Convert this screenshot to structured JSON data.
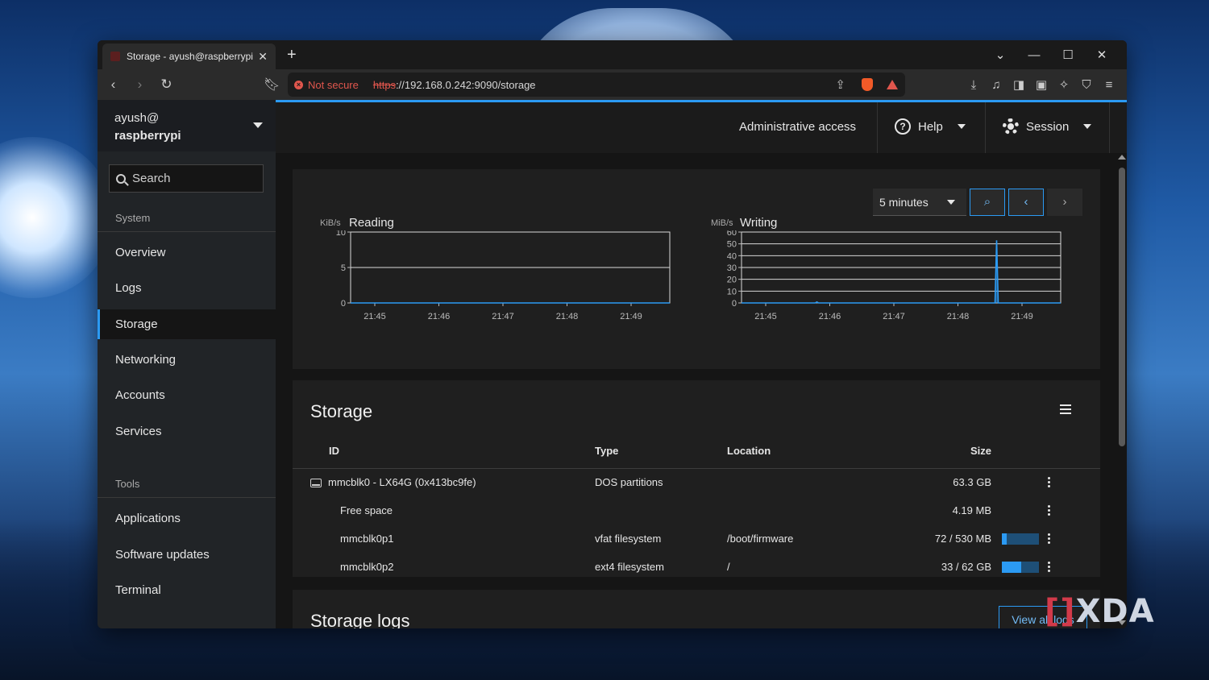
{
  "browser": {
    "tab_title": "Storage - ayush@raspberrypi",
    "security_label": "Not secure",
    "url_scheme": "https",
    "url_rest": "://192.168.0.242:9090/storage"
  },
  "sidebar": {
    "host_user": "ayush@",
    "host_name": "raspberrypi",
    "search_placeholder": "Search",
    "section_system": "System",
    "system_items": [
      "Overview",
      "Logs",
      "Storage",
      "Networking",
      "Accounts",
      "Services"
    ],
    "active_item": "Storage",
    "section_tools": "Tools",
    "tools_items": [
      "Applications",
      "Software updates",
      "Terminal"
    ]
  },
  "topbar": {
    "admin": "Administrative access",
    "help": "Help",
    "session": "Session"
  },
  "graphs": {
    "range_select": "5 minutes"
  },
  "chart_data": [
    {
      "type": "line",
      "title": "Reading",
      "ylabel": "KiB/s",
      "x": [
        "21:45",
        "21:46",
        "21:47",
        "21:48",
        "21:49"
      ],
      "yticks": [
        "0",
        "5",
        "10"
      ],
      "ylim": [
        0,
        10
      ],
      "series": [
        {
          "values": [
            0,
            0,
            0,
            0,
            0
          ]
        }
      ],
      "grid": true
    },
    {
      "type": "line",
      "title": "Writing",
      "ylabel": "MiB/s",
      "x": [
        "21:45",
        "21:46",
        "21:47",
        "21:48",
        "21:49"
      ],
      "yticks": [
        "0",
        "10",
        "20",
        "30",
        "40",
        "50",
        "60"
      ],
      "ylim": [
        0,
        60
      ],
      "series": [
        {
          "values": [
            0,
            0.8,
            0,
            0,
            53,
            0
          ]
        }
      ],
      "grid": true
    }
  ],
  "storage": {
    "title": "Storage",
    "columns": {
      "id": "ID",
      "type": "Type",
      "location": "Location",
      "size": "Size"
    },
    "rows": [
      {
        "id": "mmcblk0 - LX64G (0x413bc9fe)",
        "type": "DOS partitions",
        "location": "",
        "size": "63.3 GB",
        "usage": null
      },
      {
        "id": "Free space",
        "type": "",
        "location": "",
        "size": "4.19 MB",
        "usage": null
      },
      {
        "id": "mmcblk0p1",
        "type": "vfat filesystem",
        "location": "/boot/firmware",
        "size": "72 / 530 MB",
        "usage": 0.136
      },
      {
        "id": "mmcblk0p2",
        "type": "ext4 filesystem",
        "location": "/",
        "size": "33 / 62 GB",
        "usage": 0.53
      }
    ]
  },
  "logs": {
    "title": "Storage logs",
    "view_all": "View all logs"
  },
  "watermark": "XDA"
}
